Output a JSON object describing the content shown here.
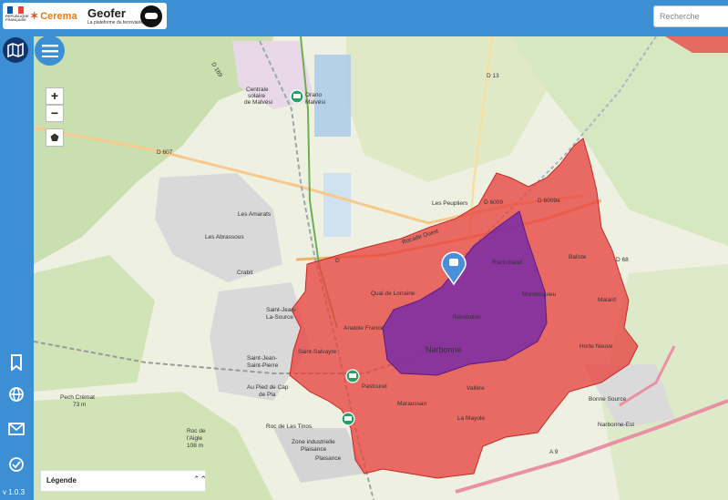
{
  "header": {
    "rf_text": "RÉPUBLIQUE FRANÇAISE",
    "cerema": "Cerema",
    "geofer_title": "Geofer",
    "geofer_subtitle": "La plateforme du ferroviaire",
    "search_placeholder": "Recherche"
  },
  "sidebar": {
    "icons": [
      "map-icon",
      "bookmark-icon",
      "globe-icon",
      "mail-icon",
      "check-circle-icon"
    ],
    "version": "v 1.0.3"
  },
  "map_controls": {
    "zoom_in": "+",
    "zoom_out": "−"
  },
  "legend": {
    "title": "Légende",
    "toggle": "⌃⌃"
  },
  "colors": {
    "brand": "#3d8fd4",
    "red_zone": "#e8423f",
    "purple_zone": "#7b2ea3",
    "station_pin": "#4a90d9",
    "bus_stop": "#21a366"
  },
  "map_labels": {
    "lesamarats": "Les Amarats",
    "lesabrassous": "Les Abrassous",
    "crabit": "Crabit",
    "stjeanlasource": "Saint-Jean-\nLa-Source",
    "stjeanstpierre": "Saint-Jean-\nSaint-Pierre",
    "aupied": "Au Pied de Cap\nde Pla",
    "pech": "Pech Crémat\n73 m",
    "roc": "Roc de Las Tinos",
    "zone": "Zone industrielle\nPlaisance",
    "plaisance": "Plaisance",
    "aigle": "Roc de\nl'Aigle\n108 m",
    "orano": "Orano\nMalvési",
    "quai": "Quai de Lorraine",
    "anatole": "Anatole France",
    "salvayre": "Saint-Salvayre",
    "pastouret": "Pastouret",
    "maraussan": "Maraussan",
    "vallere": "Vallère",
    "lamayole": "La Mayole",
    "narbonne": "Narbonne",
    "revolution": "Révolution",
    "montesquieu": "Montesquieu",
    "razimbaud": "Razimbaud",
    "baliste": "Baliste",
    "malard": "Malard",
    "horteneuve": "Horte Neuve",
    "bonnesource": "Bonne Source",
    "narbonneest": "Narbonne-Est",
    "lespeupliers": "Les Peupliers",
    "d607": "D 607",
    "d13": "D 13",
    "d6009": "D 6009",
    "d6009a": "D 6009a",
    "d68": "D 68",
    "a9": "A 9",
    "d": "D",
    "rocade": "Rocade Ouest",
    "central": "Centrale\nsolaire\nde Malvési",
    "d169": "D 169"
  }
}
